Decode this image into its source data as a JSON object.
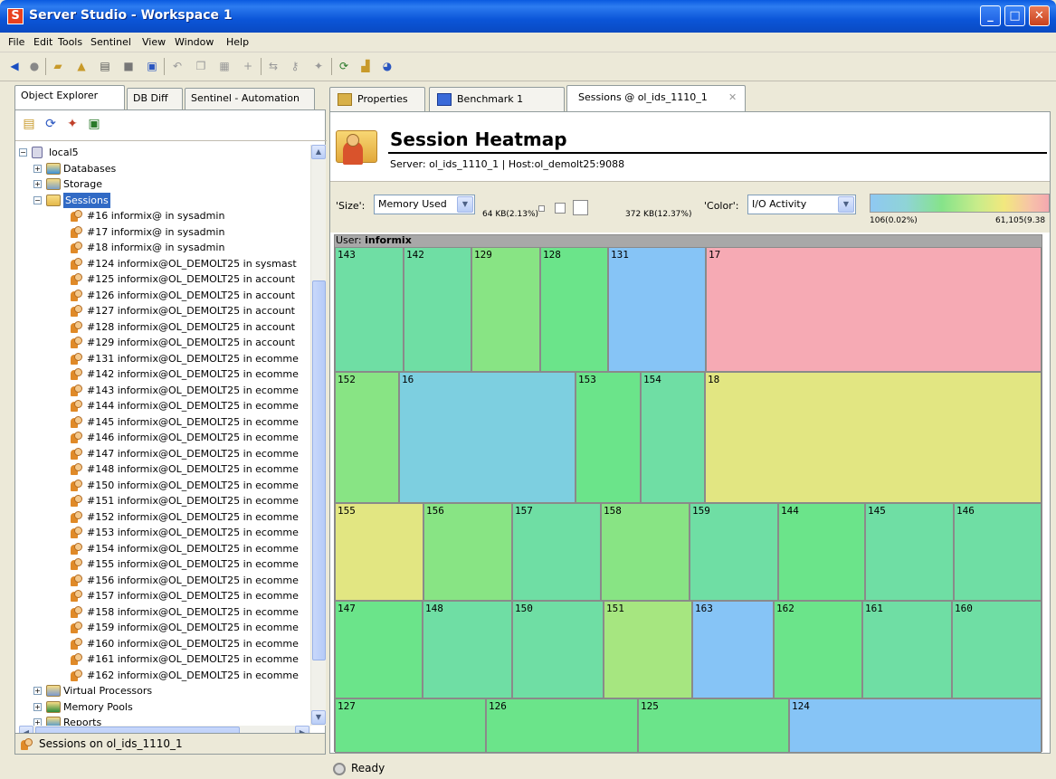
{
  "window": {
    "title": "Server Studio - Workspace 1",
    "app_icon_letter": "S"
  },
  "menu": [
    "File",
    "Edit",
    "Tools",
    "Sentinel",
    "View",
    "Window",
    "Help"
  ],
  "toolbar_icons": [
    "back-icon",
    "stop-icon",
    "open-icon",
    "upload-icon",
    "print-icon",
    "save-icon",
    "save-all-icon",
    "undo-icon",
    "copy-icon",
    "paste-icon",
    "add-icon",
    "connect-icon",
    "key-icon",
    "wand-icon",
    "refresh-icon",
    "chart-icon",
    "info-icon"
  ],
  "left": {
    "tabs": [
      "Object Explorer",
      "DB Diff",
      "Sentinel - Automation"
    ],
    "tree": {
      "root": "local5",
      "top_children": [
        "Databases",
        "Storage"
      ],
      "sessions_label": "Sessions",
      "sessions": [
        "#16 informix@ in sysadmin",
        "#17 informix@ in sysadmin",
        "#18 informix@ in sysadmin",
        "#124 informix@OL_DEMOLT25 in sysmast",
        "#125 informix@OL_DEMOLT25 in account",
        "#126 informix@OL_DEMOLT25 in account",
        "#127 informix@OL_DEMOLT25 in account",
        "#128 informix@OL_DEMOLT25 in account",
        "#129 informix@OL_DEMOLT25 in account",
        "#131 informix@OL_DEMOLT25 in ecomme",
        "#142 informix@OL_DEMOLT25 in ecomme",
        "#143 informix@OL_DEMOLT25 in ecomme",
        "#144 informix@OL_DEMOLT25 in ecomme",
        "#145 informix@OL_DEMOLT25 in ecomme",
        "#146 informix@OL_DEMOLT25 in ecomme",
        "#147 informix@OL_DEMOLT25 in ecomme",
        "#148 informix@OL_DEMOLT25 in ecomme",
        "#150 informix@OL_DEMOLT25 in ecomme",
        "#151 informix@OL_DEMOLT25 in ecomme",
        "#152 informix@OL_DEMOLT25 in ecomme",
        "#153 informix@OL_DEMOLT25 in ecomme",
        "#154 informix@OL_DEMOLT25 in ecomme",
        "#155 informix@OL_DEMOLT25 in ecomme",
        "#156 informix@OL_DEMOLT25 in ecomme",
        "#157 informix@OL_DEMOLT25 in ecomme",
        "#158 informix@OL_DEMOLT25 in ecomme",
        "#159 informix@OL_DEMOLT25 in ecomme",
        "#160 informix@OL_DEMOLT25 in ecomme",
        "#161 informix@OL_DEMOLT25 in ecomme",
        "#162 informix@OL_DEMOLT25 in ecomme"
      ],
      "bottom_children": [
        "Virtual Processors",
        "Memory Pools",
        "Reports"
      ]
    },
    "status": "Sessions on ol_ids_1110_1"
  },
  "right": {
    "tabs": [
      "Properties",
      "Benchmark 1",
      "Sessions @ ol_ids_1110_1"
    ],
    "tab_close": "✕",
    "header": {
      "title": "Session Heatmap",
      "subtitle": "Server: ol_ids_1110_1 | Host:ol_demolt25:9088"
    },
    "size_label": "'Size':",
    "size_value": "Memory Used",
    "size_min": "64 KB(2.13%)",
    "size_max": "372 KB(12.37%)",
    "color_label": "'Color':",
    "color_value": "I/O Activity",
    "color_min": "106(0.02%)",
    "color_max": "61,105(9.38",
    "heatmap_user_prefix": "User: ",
    "heatmap_user": "informix",
    "cell_colors": {
      "pink": "#f6aab4",
      "blue": "#86c4f6",
      "teal": "#7dcfe0",
      "green": "#6be48a",
      "mint": "#6fdea4",
      "lime": "#88e484",
      "yellowgreen": "#a6e680",
      "yellow": "#e2e682"
    },
    "cells": [
      {
        "label": "143",
        "color": "mint"
      },
      {
        "label": "142",
        "color": "mint"
      },
      {
        "label": "129",
        "color": "lime"
      },
      {
        "label": "128",
        "color": "green"
      },
      {
        "label": "131",
        "color": "blue"
      },
      {
        "label": "17",
        "color": "pink"
      },
      {
        "label": "152",
        "color": "lime"
      },
      {
        "label": "16",
        "color": "teal"
      },
      {
        "label": "153",
        "color": "green"
      },
      {
        "label": "154",
        "color": "mint"
      },
      {
        "label": "18",
        "color": "yellow"
      },
      {
        "label": "155",
        "color": "yellow"
      },
      {
        "label": "156",
        "color": "lime"
      },
      {
        "label": "157",
        "color": "mint"
      },
      {
        "label": "158",
        "color": "lime"
      },
      {
        "label": "159",
        "color": "mint"
      },
      {
        "label": "144",
        "color": "green"
      },
      {
        "label": "145",
        "color": "mint"
      },
      {
        "label": "146",
        "color": "mint"
      },
      {
        "label": "147",
        "color": "green"
      },
      {
        "label": "148",
        "color": "mint"
      },
      {
        "label": "150",
        "color": "mint"
      },
      {
        "label": "151",
        "color": "yellowgreen"
      },
      {
        "label": "163",
        "color": "blue"
      },
      {
        "label": "162",
        "color": "green"
      },
      {
        "label": "161",
        "color": "mint"
      },
      {
        "label": "160",
        "color": "mint"
      },
      {
        "label": "127",
        "color": "green"
      },
      {
        "label": "126",
        "color": "green"
      },
      {
        "label": "125",
        "color": "green"
      },
      {
        "label": "124",
        "color": "blue"
      }
    ],
    "status": "Ready"
  }
}
